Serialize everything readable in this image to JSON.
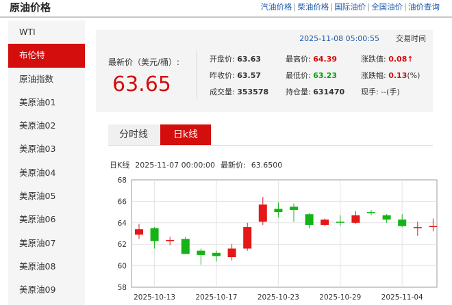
{
  "header": {
    "title": "原油价格",
    "links": [
      "汽油价格",
      "柴油价格",
      "国际油价",
      "全国油价",
      "油价查询"
    ],
    "separator": "|"
  },
  "sidebar": {
    "items": [
      {
        "label": "WTI",
        "active": false
      },
      {
        "label": "布伦特",
        "active": true
      },
      {
        "label": "原油指数",
        "active": false
      },
      {
        "label": "美原油01",
        "active": false
      },
      {
        "label": "美原油02",
        "active": false
      },
      {
        "label": "美原油03",
        "active": false
      },
      {
        "label": "美原油04",
        "active": false
      },
      {
        "label": "美原油05",
        "active": false
      },
      {
        "label": "美原油06",
        "active": false
      },
      {
        "label": "美原油07",
        "active": false
      },
      {
        "label": "美原油08",
        "active": false
      },
      {
        "label": "美原油09",
        "active": false
      }
    ]
  },
  "quote": {
    "datetime": "2025-11-08 05:00:55",
    "trading_time_label": "交易时间",
    "latest_label": "最新价（美元/桶）:",
    "latest_value": "63.65",
    "open_label": "开盘价:",
    "open_value": "63.63",
    "high_label": "最高价:",
    "high_value": "64.39",
    "change_label": "涨跌值:",
    "change_value": "0.08",
    "change_arrow": "↑",
    "prev_close_label": "昨收价:",
    "prev_close_value": "63.57",
    "low_label": "最低价:",
    "low_value": "63.23",
    "change_pct_label": "涨跌幅:",
    "change_pct_value": "0.13",
    "change_pct_unit": "(%)",
    "volume_label": "成交量:",
    "volume_value": "353578",
    "open_interest_label": "持仓量:",
    "open_interest_value": "631470",
    "current_hand_label": "现手:",
    "current_hand_value": "--(手)"
  },
  "tabs": [
    {
      "label": "分时线",
      "active": false
    },
    {
      "label": "日k线",
      "active": true
    }
  ],
  "chart_info": {
    "label": "日K线",
    "datetime": "2025-11-07 00:00:00",
    "latest_label": "最新价:",
    "latest_value": "63.6500"
  },
  "colors": {
    "accent_red": "#d40d0d",
    "up_red": "#e31818",
    "down_green": "#15b315",
    "link_blue": "#1d5aa8"
  },
  "chart_data": {
    "type": "candlestick",
    "ylim": [
      58,
      68
    ],
    "yticks": [
      58,
      60,
      62,
      64,
      66,
      68
    ],
    "xtick_labels": [
      {
        "label": "2025-10-13",
        "index": 1
      },
      {
        "label": "2025-10-17",
        "index": 5
      },
      {
        "label": "2025-10-23",
        "index": 9
      },
      {
        "label": "2025-10-29",
        "index": 13
      },
      {
        "label": "2025-11-04",
        "index": 17
      }
    ],
    "grid": true,
    "candles": [
      {
        "open": 62.9,
        "high": 63.9,
        "low": 62.5,
        "close": 63.4
      },
      {
        "open": 63.5,
        "high": 63.6,
        "low": 61.6,
        "close": 62.3
      },
      {
        "open": 62.3,
        "high": 62.7,
        "low": 61.9,
        "close": 62.4
      },
      {
        "open": 62.5,
        "high": 62.7,
        "low": 61.1,
        "close": 61.1
      },
      {
        "open": 61.4,
        "high": 61.6,
        "low": 60.1,
        "close": 61.0
      },
      {
        "open": 61.2,
        "high": 61.4,
        "low": 60.4,
        "close": 60.9
      },
      {
        "open": 60.8,
        "high": 62.0,
        "low": 60.5,
        "close": 61.6
      },
      {
        "open": 61.6,
        "high": 64.0,
        "low": 61.4,
        "close": 63.6
      },
      {
        "open": 64.1,
        "high": 66.4,
        "low": 63.8,
        "close": 65.7
      },
      {
        "open": 65.3,
        "high": 65.9,
        "low": 64.5,
        "close": 65.0
      },
      {
        "open": 65.5,
        "high": 65.8,
        "low": 64.1,
        "close": 65.2
      },
      {
        "open": 64.8,
        "high": 64.9,
        "low": 63.5,
        "close": 63.8
      },
      {
        "open": 63.8,
        "high": 64.4,
        "low": 63.7,
        "close": 64.3
      },
      {
        "open": 64.1,
        "high": 64.7,
        "low": 63.7,
        "close": 64.0
      },
      {
        "open": 64.0,
        "high": 65.1,
        "low": 63.9,
        "close": 64.7
      },
      {
        "open": 65.0,
        "high": 65.2,
        "low": 64.7,
        "close": 64.9
      },
      {
        "open": 64.7,
        "high": 64.8,
        "low": 64.0,
        "close": 64.3
      },
      {
        "open": 64.3,
        "high": 64.8,
        "low": 63.6,
        "close": 63.7
      },
      {
        "open": 63.6,
        "high": 64.1,
        "low": 62.8,
        "close": 63.6
      },
      {
        "open": 63.6,
        "high": 64.4,
        "low": 63.2,
        "close": 63.7
      }
    ]
  }
}
